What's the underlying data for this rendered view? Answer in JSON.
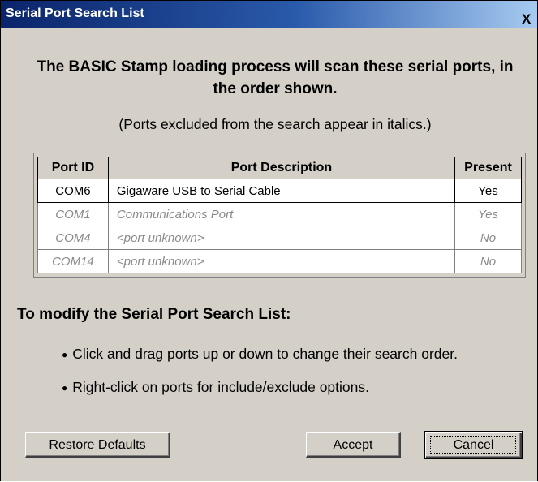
{
  "window": {
    "title": "Serial Port Search List",
    "close_glyph": "X"
  },
  "heading": "The BASIC Stamp loading process will scan these serial ports, in the order shown.",
  "note": "(Ports excluded from the search appear in italics.)",
  "table": {
    "columns": [
      "Port ID",
      "Port Description",
      "Present"
    ],
    "rows": [
      {
        "port_id": "COM6",
        "description": "Gigaware USB to Serial Cable",
        "present": "Yes",
        "excluded": false
      },
      {
        "port_id": "COM1",
        "description": "Communications Port",
        "present": "Yes",
        "excluded": true
      },
      {
        "port_id": "COM4",
        "description": "<port unknown>",
        "present": "No",
        "excluded": true
      },
      {
        "port_id": "COM14",
        "description": "<port unknown>",
        "present": "No",
        "excluded": true
      }
    ]
  },
  "modify": {
    "heading": "To modify the Serial Port Search List:",
    "bullets": [
      "Click and drag ports up or down to change their search order.",
      "Right-click on ports for include/exclude options."
    ]
  },
  "buttons": {
    "restore": {
      "accel": "R",
      "rest": "estore Defaults"
    },
    "accept": {
      "accel": "A",
      "rest": "ccept"
    },
    "cancel": {
      "accel": "C",
      "rest": "ancel"
    }
  },
  "colors": {
    "titlebar_start": "#0a246a",
    "titlebar_end": "#a6caf0",
    "dialog_face": "#d4d0c8",
    "excluded_text": "#8a8a8a"
  }
}
